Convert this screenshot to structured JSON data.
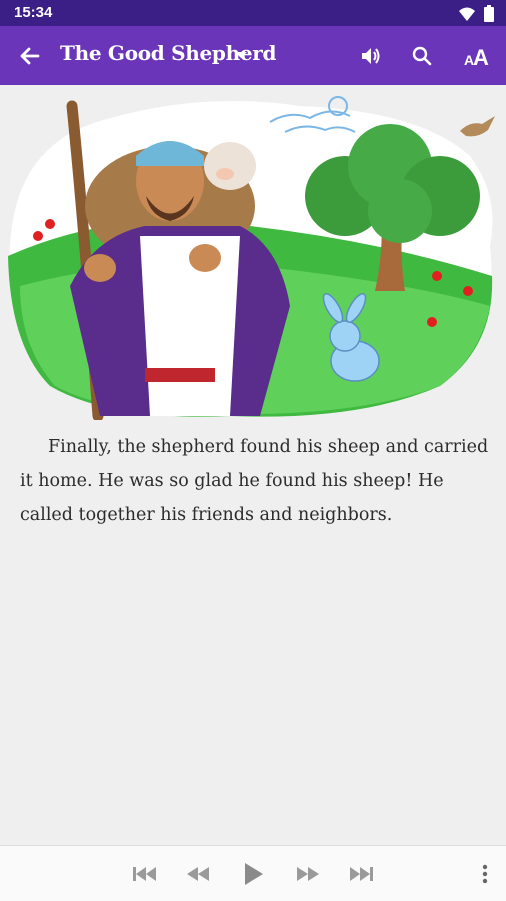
{
  "status_bar": {
    "time": "15:34",
    "icons": [
      "wifi-icon",
      "battery-icon"
    ]
  },
  "app_bar": {
    "title": "The Good Shepherd",
    "icons": [
      "back-arrow-icon",
      "dropdown-caret-icon",
      "speaker-icon",
      "search-icon",
      "text-size-icon"
    ],
    "text_size_label": "AA"
  },
  "illustration": {
    "description_visible": false
  },
  "story": {
    "text": "Finally, the shepherd found his sheep and carried it home. He was so glad he found his sheep! He called together his friends and neighbors."
  },
  "player": {
    "controls": [
      "skip-previous-icon",
      "rewind-icon",
      "play-icon",
      "fast-forward-icon",
      "skip-next-icon",
      "more-vert-icon"
    ]
  },
  "colors": {
    "status_bar": "#3c1f86",
    "app_bar": "#6a35b8",
    "background": "#efefef"
  }
}
